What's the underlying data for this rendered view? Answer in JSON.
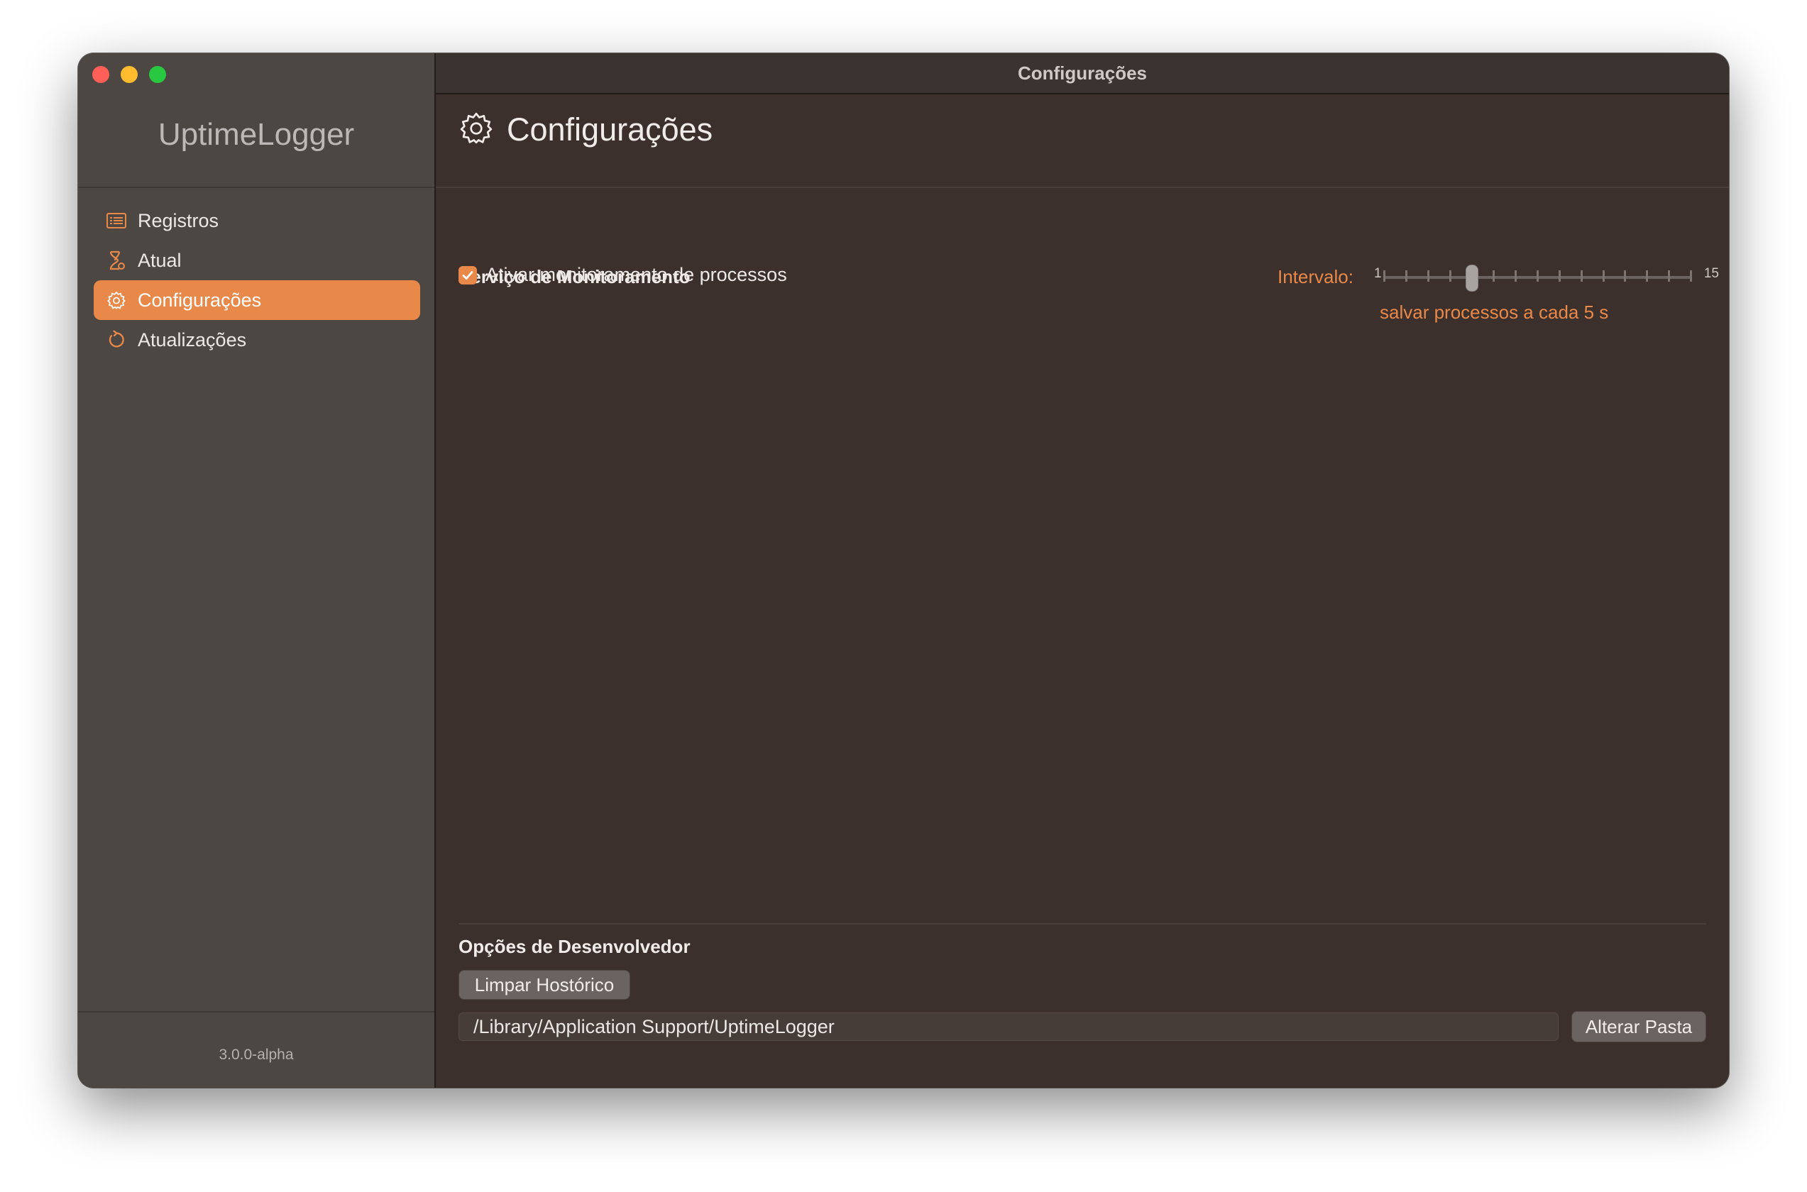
{
  "window": {
    "title": "Configurações",
    "accent_color": "#e8894a"
  },
  "sidebar": {
    "app_name": "UptimeLogger",
    "items": [
      {
        "label": "Registros",
        "icon": "list-icon",
        "active": false
      },
      {
        "label": "Atual",
        "icon": "hourglass-icon",
        "active": false
      },
      {
        "label": "Configurações",
        "icon": "gear-icon",
        "active": true
      },
      {
        "label": "Atualizações",
        "icon": "refresh-icon",
        "active": false
      }
    ],
    "version": "3.0.0-alpha"
  },
  "main": {
    "page_title": "Configurações",
    "monitoring": {
      "section_title": "Serviço de Monitoramento",
      "checkbox_label": "Ativar monitoramento de processos",
      "checkbox_checked": true,
      "interval_label": "Intervalo:",
      "slider_min": "1",
      "slider_max": "15",
      "slider_value": 5,
      "interval_caption": "salvar processos a cada 5 s"
    },
    "developer": {
      "section_title": "Opções de Desenvolvedor",
      "clear_history_label": "Limpar Hostórico",
      "folder_path": "/Library/Application Support/UptimeLogger",
      "change_folder_label": "Alterar Pasta"
    }
  }
}
